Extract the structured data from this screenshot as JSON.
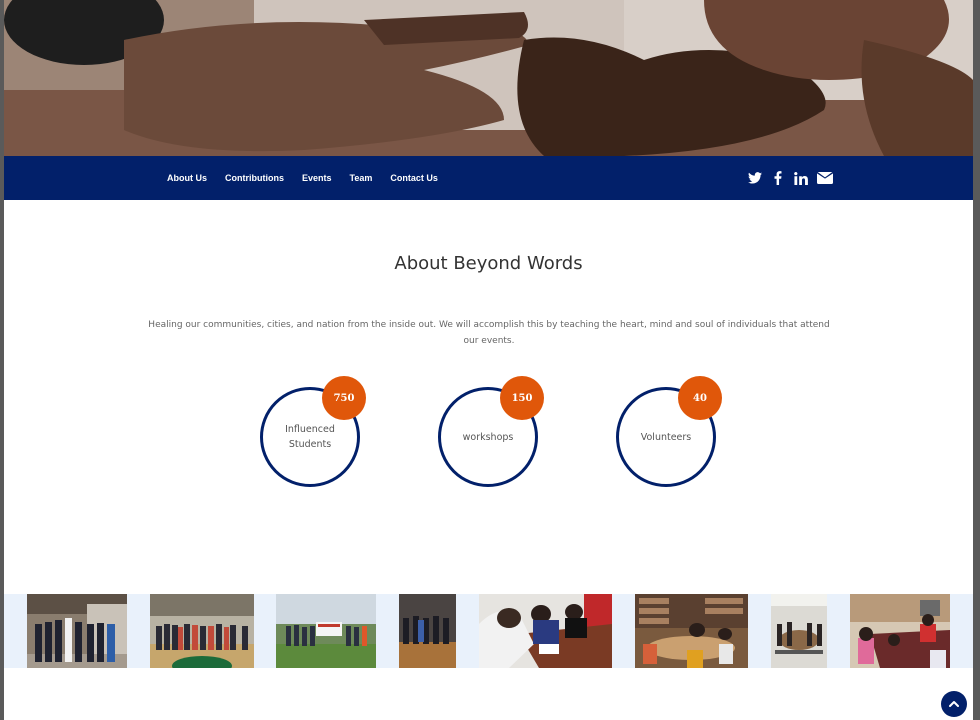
{
  "hero": {
    "image": "hands-together-photo"
  },
  "nav": {
    "links": [
      {
        "label": "About Us"
      },
      {
        "label": "Contributions"
      },
      {
        "label": "Events"
      },
      {
        "label": "Team"
      },
      {
        "label": "Contact Us"
      }
    ],
    "social": [
      {
        "icon": "twitter-icon"
      },
      {
        "icon": "facebook-icon"
      },
      {
        "icon": "linkedin-icon"
      },
      {
        "icon": "envelope-icon"
      }
    ]
  },
  "about": {
    "title": "About Beyond Words",
    "text": "Healing our communities, cities, and nation from the inside out. We will accomplish this by teaching the heart, mind and soul of individuals that attend our events."
  },
  "counters": [
    {
      "value": "750",
      "label": "Influenced Students"
    },
    {
      "value": "150",
      "label": "workshops"
    },
    {
      "value": "40",
      "label": "Volunteers"
    }
  ],
  "gallery": {
    "photos": [
      "group-photo-hallway",
      "group-photo-gym",
      "group-photo-field-banner",
      "group-photo-stage",
      "students-writing-table",
      "students-library",
      "workshop-room",
      "students-classroom"
    ]
  },
  "colors": {
    "navy": "#02206a",
    "orange": "#e0570a",
    "gallery_bg": "#e9f1fb"
  },
  "back_to_top": {
    "icon": "chevron-up-icon"
  }
}
